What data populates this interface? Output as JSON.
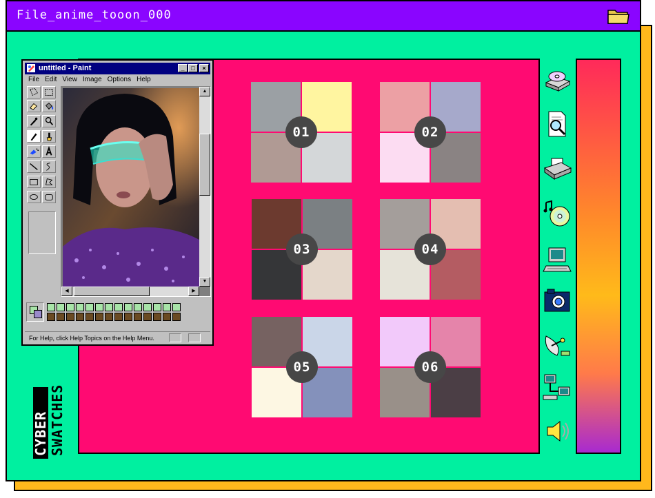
{
  "window": {
    "title": "File_anime_tooon_000"
  },
  "swatches": [
    {
      "label": "01",
      "colors": [
        "#9ba0a4",
        "#fff5a0",
        "#b09a94",
        "#d4d7d9"
      ]
    },
    {
      "label": "02",
      "colors": [
        "#eca0a4",
        "#a6a9cb",
        "#fcdcf2",
        "#8a8383"
      ]
    },
    {
      "label": "03",
      "colors": [
        "#6c3a2f",
        "#7b8083",
        "#353638",
        "#e4d7cb"
      ]
    },
    {
      "label": "04",
      "colors": [
        "#a49e9b",
        "#e4beb1",
        "#e6e3d9",
        "#b45c62"
      ]
    },
    {
      "label": "05",
      "colors": [
        "#766261",
        "#cad6e8",
        "#fdf7e3",
        "#8491bb"
      ]
    },
    {
      "label": "06",
      "colors": [
        "#f2c9fa",
        "#e584aa",
        "#999089",
        "#4b3e45"
      ]
    }
  ],
  "side_icons": [
    "cd-drive-icon",
    "document-search-icon",
    "printer-icon",
    "music-cd-icon",
    "computer-icon",
    "camera-icon",
    "satellite-dish-icon",
    "network-icon",
    "speaker-icon"
  ],
  "brand": {
    "line1": "CYBER",
    "line2": "SWATCHES"
  },
  "paint": {
    "title": "untitled - Paint",
    "menu": [
      "File",
      "Edit",
      "View",
      "Image",
      "Options",
      "Help"
    ],
    "status": "For Help, click Help Topics on the Help Menu."
  },
  "colors": {
    "background": "#00f0a0",
    "titlebar": "#8a05ff",
    "panel": "#ff0a72",
    "shadow": "#ffb81c"
  }
}
